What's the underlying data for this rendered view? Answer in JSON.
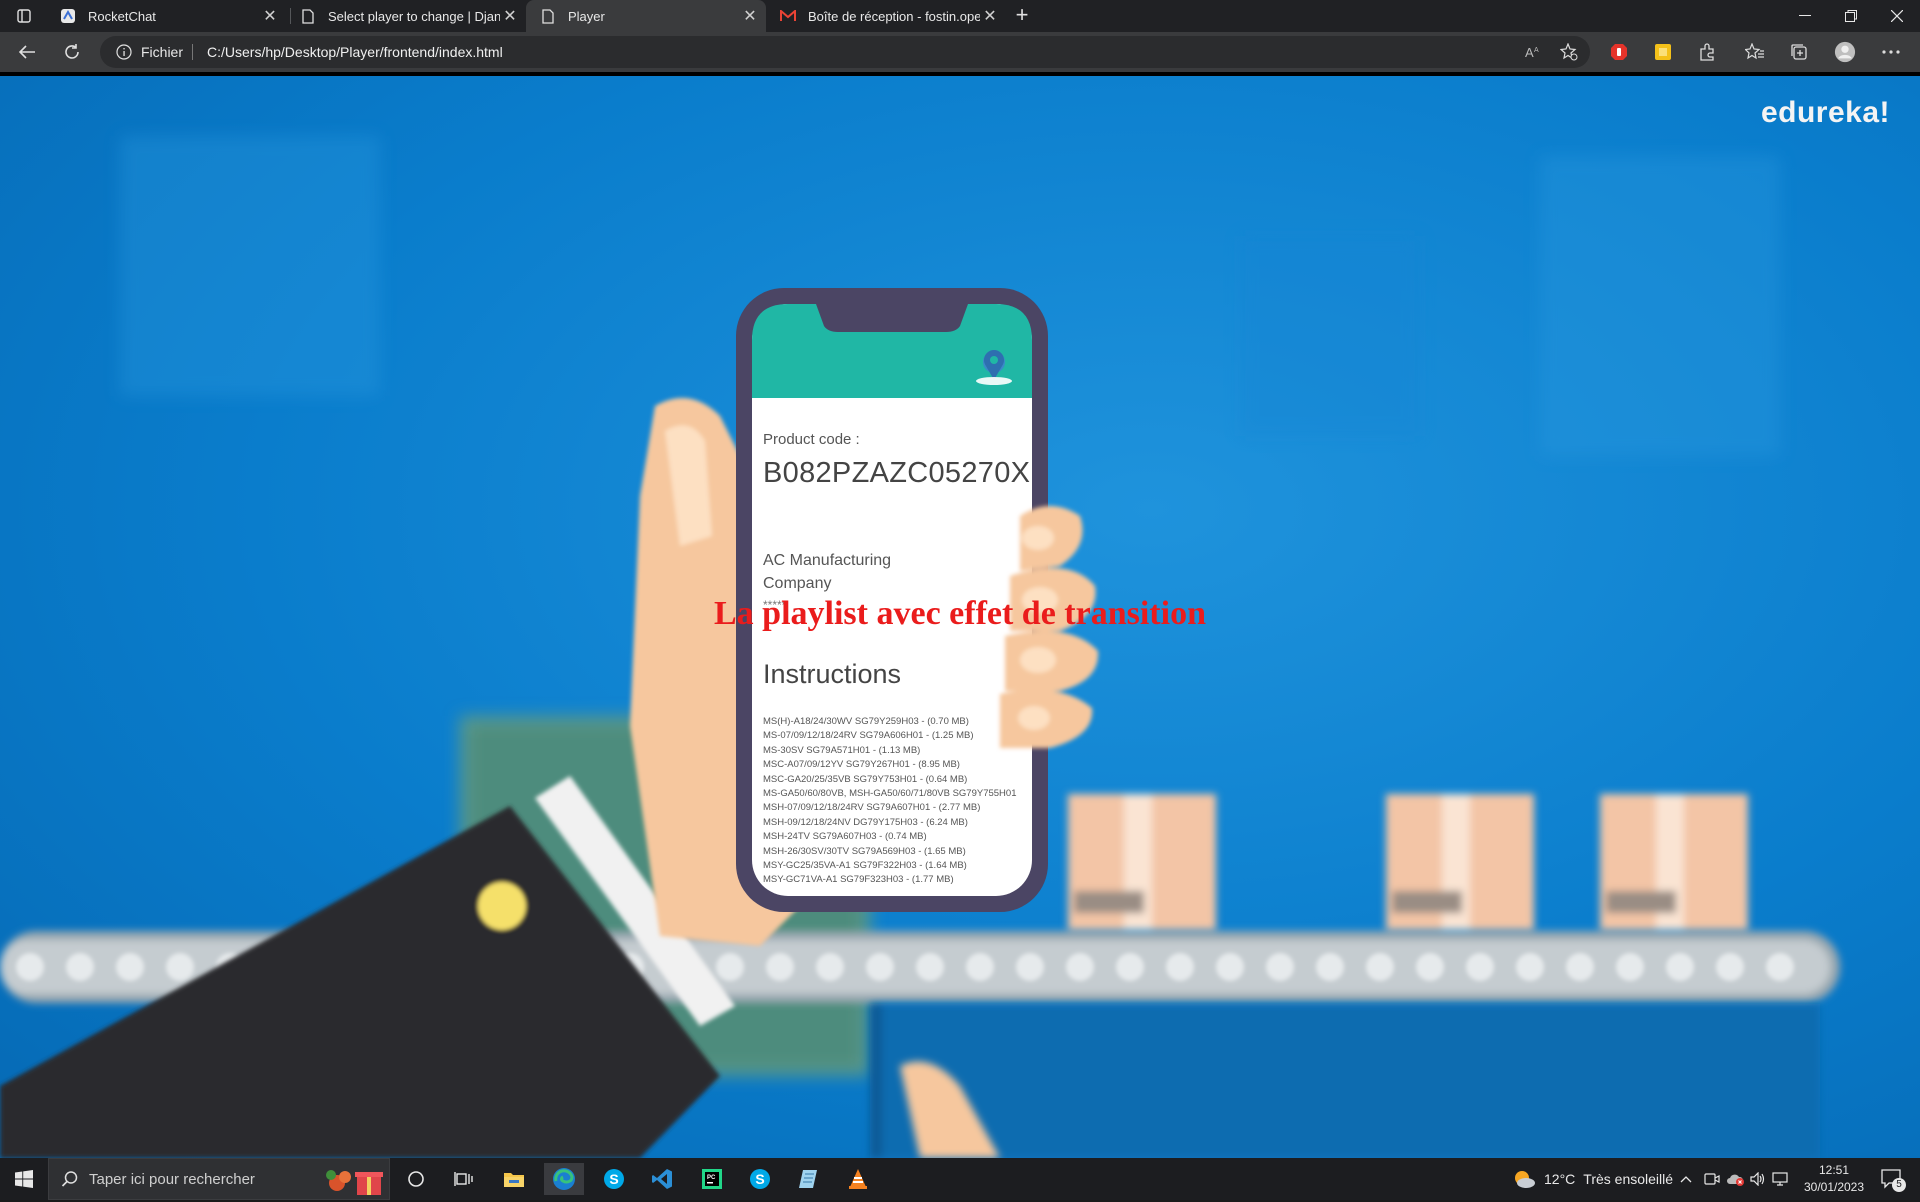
{
  "browser": {
    "tabs": [
      {
        "title": "RocketChat",
        "favicon": "rocketchat-icon",
        "active": false
      },
      {
        "title": "Select player to change | Django",
        "favicon": "page-icon",
        "active": false
      },
      {
        "title": "Player",
        "favicon": "page-icon",
        "active": true
      },
      {
        "title": "Boîte de réception - fostin.opensi",
        "favicon": "gmail-icon",
        "active": false
      }
    ],
    "address": {
      "scheme_label": "Fichier",
      "url": "C:/Users/hp/Desktop/Player/frontend/index.html"
    }
  },
  "page": {
    "logo": "edureka!",
    "headline": "La playlist avec effet de transition",
    "phone": {
      "product_code_label": "Product code :",
      "product_code": "B082PZAZC05270X",
      "manufacturer": "AC Manufacturing Company",
      "rating": "*****",
      "instructions_title": "Instructions",
      "instructions": [
        "MS(H)-A18/24/30WV SG79Y259H03 - (0.70 MB)",
        "MS-07/09/12/18/24RV SG79A606H01 - (1.25 MB)",
        "MS-30SV SG79A571H01 - (1.13 MB)",
        "MSC-A07/09/12YV SG79Y267H01 - (8.95 MB)",
        "MSC-GA20/25/35VB SG79Y753H01 - (0.64 MB)",
        "MS-GA50/60/80VB, MSH-GA50/60/71/80VB SG79Y755H01",
        "MSH-07/09/12/18/24RV SG79A607H01 - (2.77 MB)",
        "MSH-09/12/18/24NV DG79Y175H03 - (6.24 MB)",
        "MSH-24TV SG79A607H03 - (0.74 MB)",
        "MSH-26/30SV/30TV SG79A569H03 - (1.65 MB)",
        "MSY-GC25/35VA-A1 SG79F322H03 - (1.64 MB)",
        "MSY-GC71VA-A1 SG79F323H03 - (1.77 MB)"
      ]
    }
  },
  "taskbar": {
    "search_placeholder": "Taper ici pour rechercher",
    "weather": {
      "temp": "12°C",
      "condition": "Très ensoleillé"
    },
    "time": "12:51",
    "date": "30/01/2023",
    "notification_count": "5",
    "apps": [
      "task-view",
      "file-explorer",
      "edge",
      "skype",
      "vscode",
      "pycharm",
      "skype",
      "notepad",
      "vlc"
    ]
  }
}
